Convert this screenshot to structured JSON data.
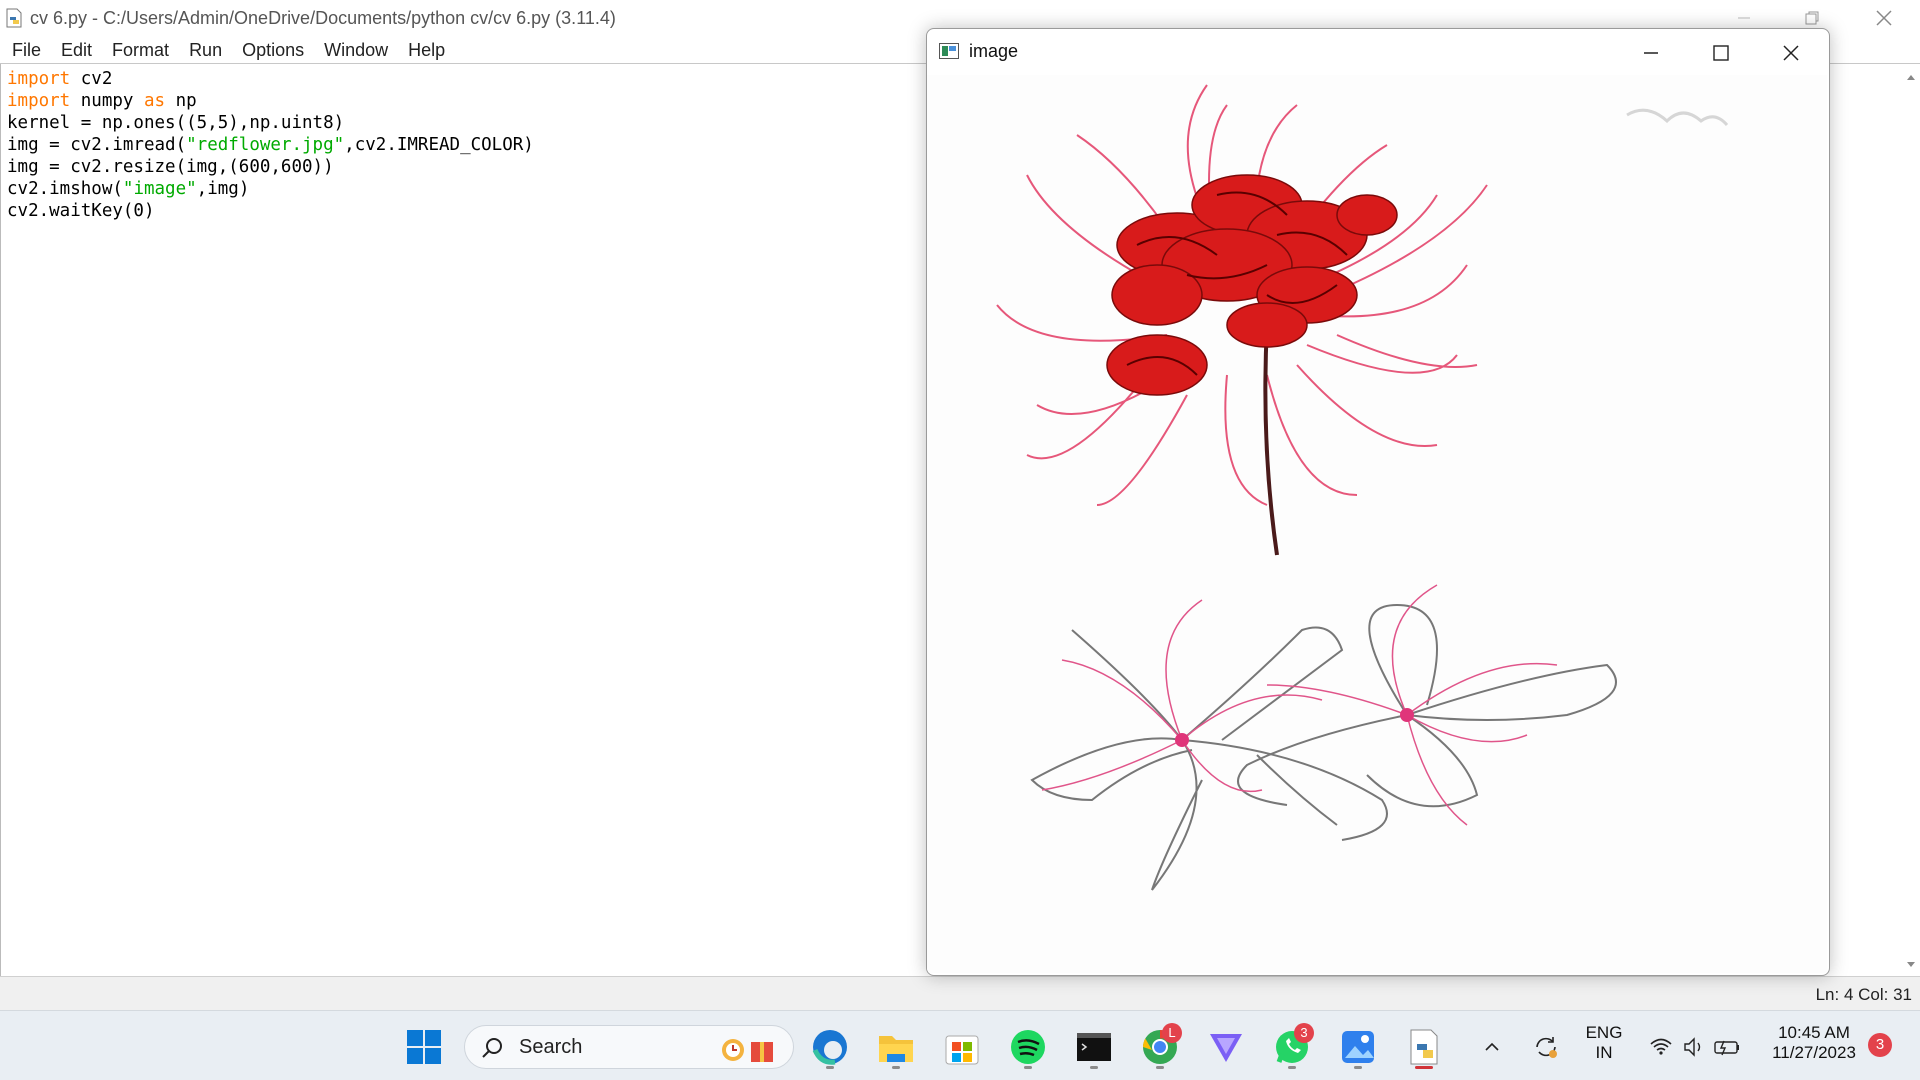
{
  "idle": {
    "title": "cv 6.py - C:/Users/Admin/OneDrive/Documents/python cv/cv 6.py (3.11.4)",
    "menu": [
      "File",
      "Edit",
      "Format",
      "Run",
      "Options",
      "Window",
      "Help"
    ],
    "code_lines": [
      "import cv2",
      "import numpy as np",
      "kernel = np.ones((5,5),np.uint8)",
      "img = cv2.imread(\"redflower.jpg\",cv2.IMREAD_COLOR)",
      "img = cv2.resize(img,(600,600))",
      "cv2.imshow(\"image\",img)",
      "cv2.waitKey(0)"
    ],
    "status": "Ln: 4   Col: 31"
  },
  "image_window": {
    "title": "image"
  },
  "taskbar": {
    "search_label": "Search",
    "apps": [
      {
        "name": "start",
        "icon": "windows-logo-icon"
      },
      {
        "name": "edge",
        "icon": "edge-icon"
      },
      {
        "name": "file-explorer",
        "icon": "folder-icon"
      },
      {
        "name": "microsoft-store",
        "icon": "store-icon"
      },
      {
        "name": "spotify",
        "icon": "spotify-icon"
      },
      {
        "name": "terminal",
        "icon": "terminal-icon"
      },
      {
        "name": "chrome",
        "icon": "chrome-icon",
        "badge": "L"
      },
      {
        "name": "proton-vpn",
        "icon": "vpn-icon"
      },
      {
        "name": "whatsapp",
        "icon": "whatsapp-icon",
        "badge": "3"
      },
      {
        "name": "photos",
        "icon": "photos-icon"
      },
      {
        "name": "idle",
        "icon": "python-idle-icon"
      }
    ],
    "tray": {
      "lang_line1": "ENG",
      "lang_line2": "IN",
      "time": "10:45 AM",
      "date": "11/27/2023",
      "notification_count": "3"
    }
  }
}
